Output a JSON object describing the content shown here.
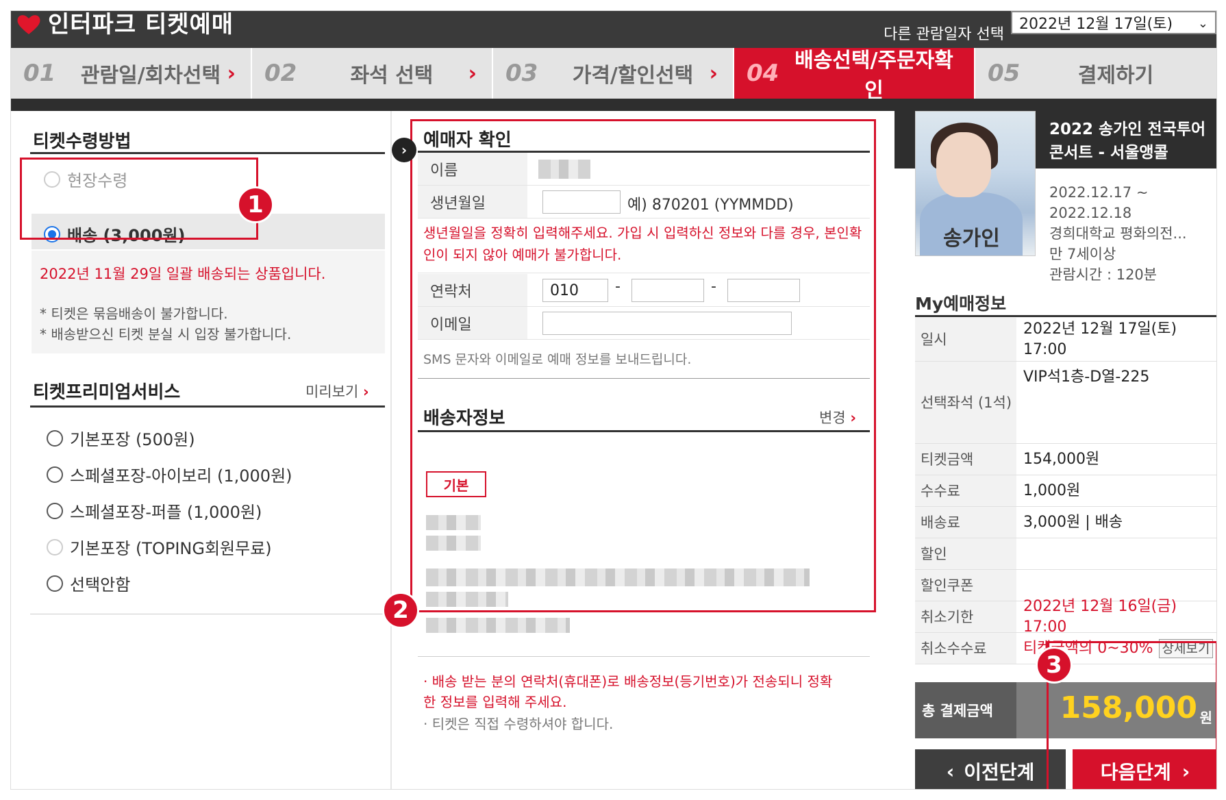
{
  "header": {
    "brand": "인터파크 티켓예매",
    "date_label": "다른 관람일자 선택",
    "date_value": "2022년 12월 17일(토)"
  },
  "steps": [
    {
      "num": "01",
      "label": "관람일/회차선택",
      "active": false
    },
    {
      "num": "02",
      "label": "좌석 선택",
      "active": false
    },
    {
      "num": "03",
      "label": "가격/할인선택",
      "active": false
    },
    {
      "num": "04",
      "label": "배송선택/주문자확인",
      "active": true
    },
    {
      "num": "05",
      "label": "결제하기",
      "active": false
    }
  ],
  "ticket_method": {
    "title": "티켓수령방법",
    "options": [
      {
        "label": "현장수령",
        "checked": false,
        "disabled": true
      },
      {
        "label": "배송 (3,000원)",
        "checked": true,
        "disabled": false
      }
    ],
    "delivery_note": "2022년 11월 29일 일괄 배송되는 상품입니다.",
    "notes": [
      "* 티켓은 묶음배송이 불가합니다.",
      "* 배송받으신 티켓 분실 시 입장 불가합니다."
    ]
  },
  "premium": {
    "title": "티켓프리미엄서비스",
    "preview": "미리보기",
    "options": [
      {
        "label": "기본포장 (500원)",
        "disabled": false
      },
      {
        "label": "스페셜포장-아이보리 (1,000원)",
        "disabled": false
      },
      {
        "label": "스페셜포장-퍼플 (1,000원)",
        "disabled": false
      },
      {
        "label": "기본포장 (TOPING회원무료)",
        "disabled": true
      },
      {
        "label": "선택안함",
        "disabled": false
      }
    ]
  },
  "booker": {
    "title": "예매자 확인",
    "name_label": "이름",
    "birth_label": "생년월일",
    "birth_hint": "예) 870201 (YYMMDD)",
    "birth_warning": "생년월일을 정확히 입력해주세요. 가입 시 입력하신 정보와 다를 경우, 본인확인이 되지 않아 예매가 불가합니다.",
    "phone_label": "연락처",
    "phone_prefix": "010",
    "phone_dash": "-",
    "email_label": "이메일",
    "sms_note": "SMS 문자와 이메일로 예매 정보를 보내드립니다."
  },
  "shipping": {
    "title": "배송자정보",
    "change": "변경",
    "tag": "기본",
    "notes": [
      "배송 받는 분의 연락처(휴대폰)로 배송정보(등기번호)가 전송되니 정확한 정보를 입력해 주세요.",
      "티켓은 직접 수령하셔야 합니다."
    ]
  },
  "performance": {
    "title": "2022 송가인 전국투어 콘서트 - 서울앵콜",
    "period": "2022.12.17 ~ 2022.12.18",
    "venue": "경희대학교 평화의전...",
    "age": "만 7세이상",
    "duration": "관람시간 : 120분",
    "poster_text": "송가인"
  },
  "my_booking": {
    "title": "My예매정보",
    "rows": [
      {
        "k": "일시",
        "v": "2022년 12월 17일(토) 17:00"
      },
      {
        "k": "선택좌석 (1석)",
        "v": "VIP석1층-D열-225"
      },
      {
        "k": "티켓금액",
        "v": "154,000원"
      },
      {
        "k": "수수료",
        "v": "1,000원"
      },
      {
        "k": "배송료",
        "v": "3,000원 | 배송"
      },
      {
        "k": "할인",
        "v": ""
      },
      {
        "k": "할인쿠폰",
        "v": ""
      },
      {
        "k": "취소기한",
        "v": "2022년 12월 16일(금) 17:00"
      },
      {
        "k": "취소수수료",
        "v": "티켓금액의 0~30%"
      }
    ],
    "detail_btn": "상세보기",
    "total_label": "총 결제금액",
    "total_value": "158,000",
    "total_unit": "원"
  },
  "buttons": {
    "prev": "이전단계",
    "next": "다음단계"
  },
  "callouts": [
    "1",
    "2",
    "3"
  ],
  "colors": {
    "accent": "#d6112b",
    "dark": "#3a3a3a",
    "total_amount": "#ffd21f"
  }
}
